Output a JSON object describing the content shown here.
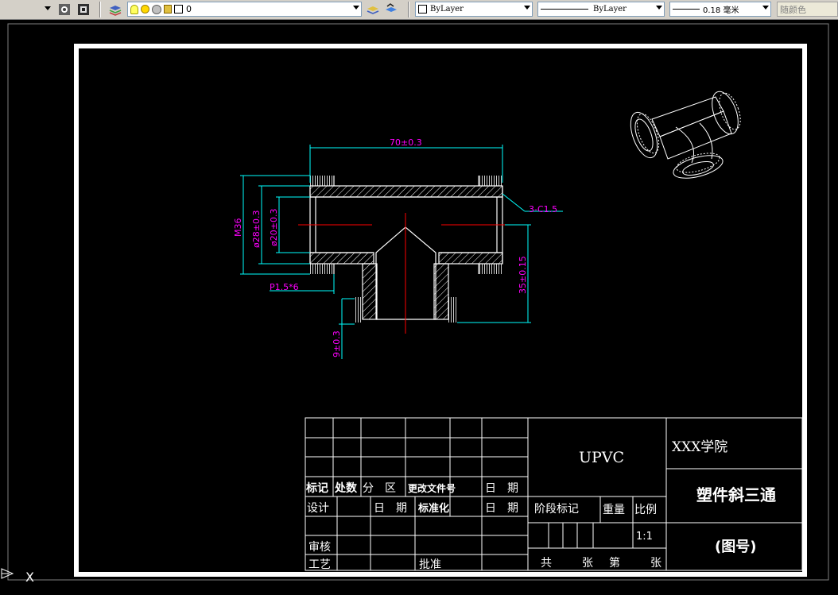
{
  "toolbar": {
    "layer_name": "0",
    "color_value": "ByLayer",
    "linetype_value": "ByLayer",
    "lineweight_value": "0.18 毫米",
    "plotstyle_value": "随颜色"
  },
  "drawing": {
    "dim_length": "70±0.3",
    "dim_chamfer": "3-C1.5",
    "dim_thread": "M36",
    "dim_outer_dia": "ø28±0.3",
    "dim_inner_dia": "ø20±0.3",
    "dim_pitch": "P1.5*6",
    "dim_branch_height": "35±0.15",
    "dim_branch_offset": "9±0.3"
  },
  "title_block": {
    "material": "UPVC",
    "school": "XXX学院",
    "part_name": "塑件斜三通",
    "drawing_no": "(图号)",
    "row_mark": [
      "标记",
      "处数",
      "分　区",
      "更改文件号",
      "日　期"
    ],
    "row_design": [
      "设计",
      "日　期",
      "标准化",
      "日　期"
    ],
    "review": "审核",
    "process": "工艺",
    "approve": "批准",
    "stage_mark": "阶段标记",
    "weight": "重量",
    "scale_label": "比例",
    "scale_value": "1:1",
    "total": "共",
    "sheets": "张",
    "number": "第",
    "sheet": "张"
  },
  "ucs": {
    "x_label": "X"
  },
  "colors": {
    "toolbar_bg": "#d4d0c8",
    "canvas_bg": "#000000",
    "outline": "#ffffff",
    "dimension": "#00ffff",
    "dim_text": "#ff00ff",
    "centerline": "#ff0000"
  }
}
